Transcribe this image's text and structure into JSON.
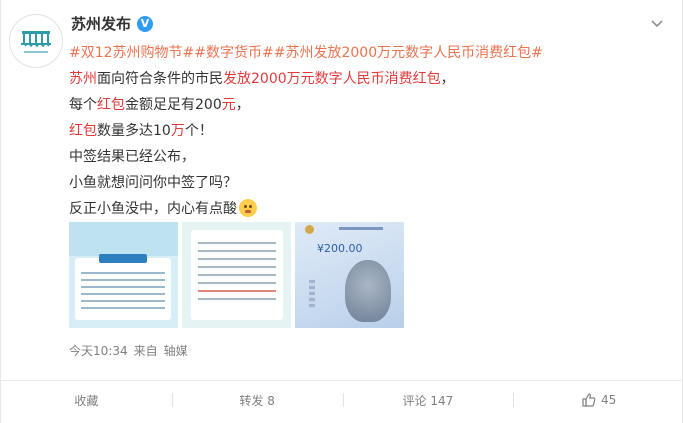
{
  "author": {
    "name": "苏州发布",
    "verified_mark": "V"
  },
  "post": {
    "line1": [
      {
        "text": "#双12苏州购物节#",
        "type": "topic"
      },
      {
        "text": "#数字货币#",
        "type": "topic"
      },
      {
        "text": "#苏州发放2000万元数字人民币消费红包#",
        "type": "topic"
      }
    ],
    "line2": [
      {
        "text": "苏州",
        "type": "kw"
      },
      {
        "text": "面向符合条件的市民",
        "type": "plain"
      },
      {
        "text": "发放2000万元数字人民币消费红包",
        "type": "kw"
      },
      {
        "text": "，",
        "type": "plain"
      }
    ],
    "line3": [
      {
        "text": "每个",
        "type": "plain"
      },
      {
        "text": "红包",
        "type": "kw"
      },
      {
        "text": "金额足足有200",
        "type": "plain"
      },
      {
        "text": "元",
        "type": "kw"
      },
      {
        "text": "，",
        "type": "plain"
      }
    ],
    "line4": [
      {
        "text": "红包",
        "type": "kw"
      },
      {
        "text": "数量多达10",
        "type": "plain"
      },
      {
        "text": "万",
        "type": "kw"
      },
      {
        "text": "个！",
        "type": "plain"
      }
    ],
    "line5": "中签结果已经公布，",
    "line6": "小鱼就想问问你中签了吗？",
    "line7": "反正小鱼没中，内心有点酸"
  },
  "thumbnails": {
    "t3_amount": "¥200.00"
  },
  "meta": {
    "time": "今天10:34",
    "from_label": "来自",
    "source": "轴媒"
  },
  "actions": {
    "favorite": "收藏",
    "repost": "转发 8",
    "comment": "评论 147",
    "like": "45"
  }
}
